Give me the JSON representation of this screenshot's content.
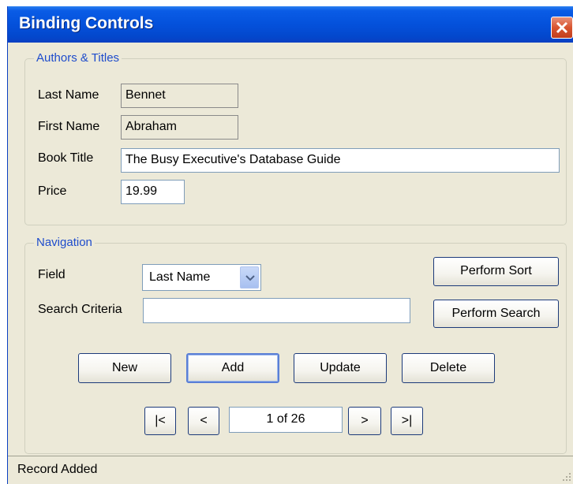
{
  "window": {
    "title": "Binding Controls"
  },
  "authors_group": {
    "legend": "Authors & Titles",
    "last_name_label": "Last Name",
    "last_name_value": "Bennet",
    "first_name_label": "First Name",
    "first_name_value": "Abraham",
    "book_title_label": "Book Title",
    "book_title_value": "The Busy Executive's Database Guide",
    "price_label": "Price",
    "price_value": "19.99"
  },
  "navigation_group": {
    "legend": "Navigation",
    "field_label": "Field",
    "field_selected": "Last Name",
    "search_label": "Search Criteria",
    "search_value": "",
    "sort_button": "Perform Sort",
    "search_button": "Perform Search",
    "new_button": "New",
    "add_button": "Add",
    "update_button": "Update",
    "delete_button": "Delete",
    "first_button": "|<",
    "prev_button": "<",
    "position": "1 of 26",
    "next_button": ">",
    "last_button": ">|"
  },
  "status": {
    "text": "Record Added"
  }
}
